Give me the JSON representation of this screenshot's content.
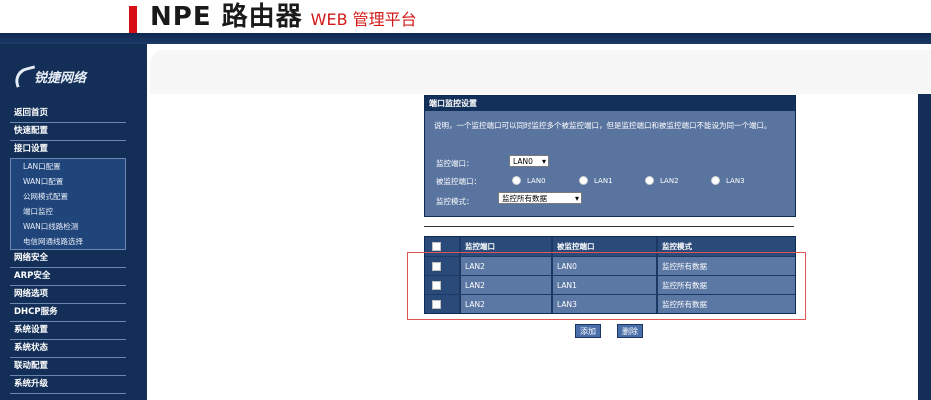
{
  "header": {
    "title": "NPE 路由器",
    "subtitle": "WEB 管理平台"
  },
  "logo": {
    "text": "锐捷网络"
  },
  "menu": {
    "items": [
      {
        "label": "返回首页"
      },
      {
        "label": "快速配置"
      },
      {
        "label": "接口设置"
      }
    ],
    "subitems": [
      {
        "label": "LAN口配置"
      },
      {
        "label": "WAN口配置"
      },
      {
        "label": "公网模式配置"
      },
      {
        "label": "端口监控"
      },
      {
        "label": "WAN口线路检测"
      },
      {
        "label": "电信网通线路选择"
      }
    ],
    "items_after": [
      {
        "label": "网络安全"
      },
      {
        "label": "ARP安全"
      },
      {
        "label": "网络选项"
      },
      {
        "label": "DHCP服务"
      },
      {
        "label": "系统设置"
      },
      {
        "label": "系统状态"
      },
      {
        "label": "联动配置"
      },
      {
        "label": "系统升级"
      }
    ]
  },
  "panel": {
    "title": "端口监控设置",
    "description": "说明，一个监控端口可以同时监控多个被监控端口，但是监控端口和被监控端口不能设为同一个端口。",
    "monitor_port_label": "监控端口：",
    "monitor_port_value": "LAN0",
    "monitored_port_label": "被监控端口：",
    "radio_options": [
      "LAN0",
      "LAN1",
      "LAN2",
      "LAN3"
    ],
    "mode_label": "监控模式：",
    "mode_value": "监控所有数据"
  },
  "table": {
    "headers": [
      "监控端口",
      "被监控端口",
      "监控模式"
    ],
    "rows": [
      {
        "monitor": "LAN2",
        "monitored": "LAN0",
        "mode": "监控所有数据"
      },
      {
        "monitor": "LAN2",
        "monitored": "LAN1",
        "mode": "监控所有数据"
      },
      {
        "monitor": "LAN2",
        "monitored": "LAN3",
        "mode": "监控所有数据"
      }
    ]
  },
  "buttons": {
    "add": "添加",
    "delete": "删除"
  }
}
